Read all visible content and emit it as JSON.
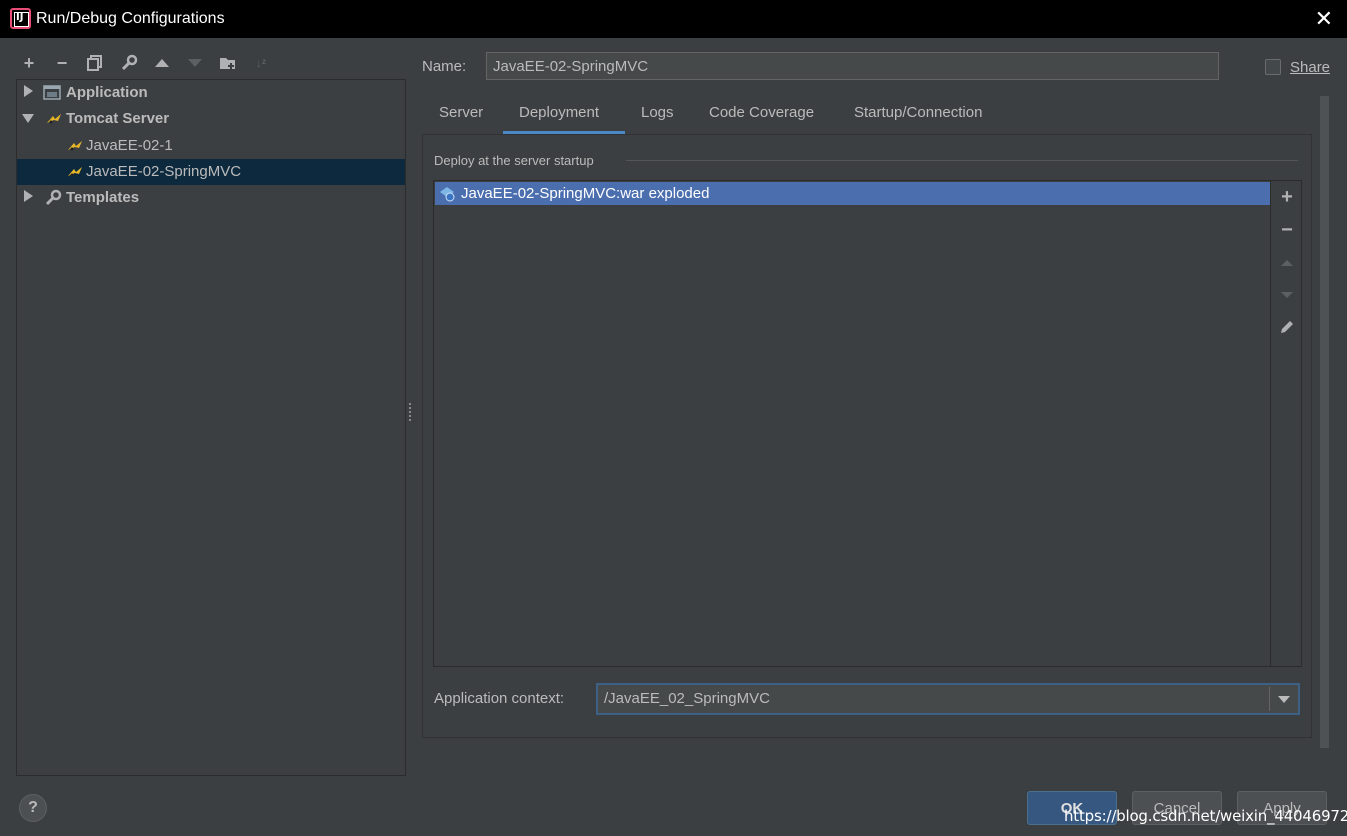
{
  "window": {
    "title": "Run/Debug Configurations",
    "app_icon_text": "IJ"
  },
  "toolbar": {
    "icons": [
      "add-icon",
      "remove-icon",
      "copy-icon",
      "wrench-icon",
      "move-up-icon",
      "move-down-icon",
      "new-folder-icon",
      "sort-icon"
    ]
  },
  "tree": {
    "items": [
      {
        "label": "Application",
        "expanded": false,
        "icon": "application-icon",
        "bold": true
      },
      {
        "label": "Tomcat Server",
        "expanded": true,
        "icon": "tomcat-icon",
        "bold": true
      },
      {
        "label": "JavaEE-02-1",
        "icon": "tomcat-icon"
      },
      {
        "label": "JavaEE-02-SpringMVC",
        "icon": "tomcat-icon",
        "selected": true
      },
      {
        "label": "Templates",
        "expanded": false,
        "icon": "wrench-icon",
        "bold": true
      }
    ]
  },
  "config": {
    "name_label": "Name:",
    "name_value": "JavaEE-02-SpringMVC",
    "share_label": "Share",
    "share_checked": false
  },
  "tabs": [
    {
      "label": "Server"
    },
    {
      "label": "Deployment",
      "active": true
    },
    {
      "label": "Logs"
    },
    {
      "label": "Code Coverage"
    },
    {
      "label": "Startup/Connection"
    }
  ],
  "deployment": {
    "group_title": "Deploy at the server startup",
    "items": [
      {
        "label": "JavaEE-02-SpringMVC:war exploded",
        "icon": "artifact-icon",
        "selected": true
      }
    ],
    "tools": [
      "add-icon",
      "remove-icon",
      "move-up-icon",
      "move-down-icon",
      "edit-icon"
    ],
    "context_label": "Application context:",
    "context_value": "/JavaEE_02_SpringMVC"
  },
  "footer": {
    "help_label": "?",
    "ok_label": "OK",
    "cancel_label": "Cancel",
    "apply_label": "Apply"
  },
  "watermark": "https://blog.csdn.net/weixin_44046972",
  "colors": {
    "background": "#3c3f41",
    "selection_tree": "#0d293e",
    "selection_list": "#4b6eaf",
    "accent": "#4a88c7",
    "ok_button": "#365880"
  }
}
